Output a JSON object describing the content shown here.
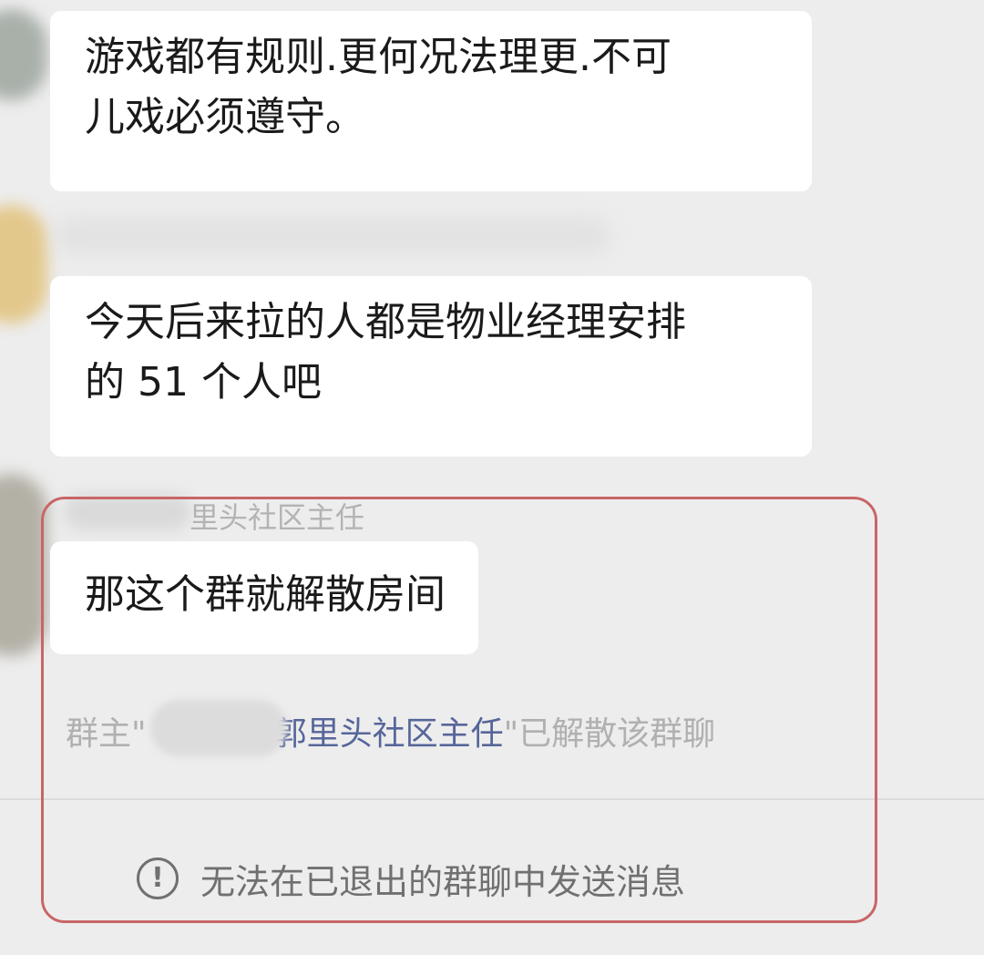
{
  "messages": [
    {
      "text_line1": "游戏都有规则.更何况法理更.不可",
      "text_line2": "儿戏必须遵守。"
    },
    {
      "text_line1": "今天后来拉的人都是物业经理安排",
      "text_line2": "的 51 个人吧"
    },
    {
      "sender": "里头社区主任",
      "text": "那这个群就解散房间"
    }
  ],
  "system_message": {
    "prefix": "群主\"",
    "name_visible": "郭里头社区主任",
    "suffix": "\"已解散该群聊"
  },
  "notice": {
    "icon": "exclamation-circle-icon",
    "text": "无法在已退出的群聊中发送消息"
  },
  "colors": {
    "highlight_border": "#c96566",
    "link": "#57669a",
    "background": "#ededed"
  }
}
